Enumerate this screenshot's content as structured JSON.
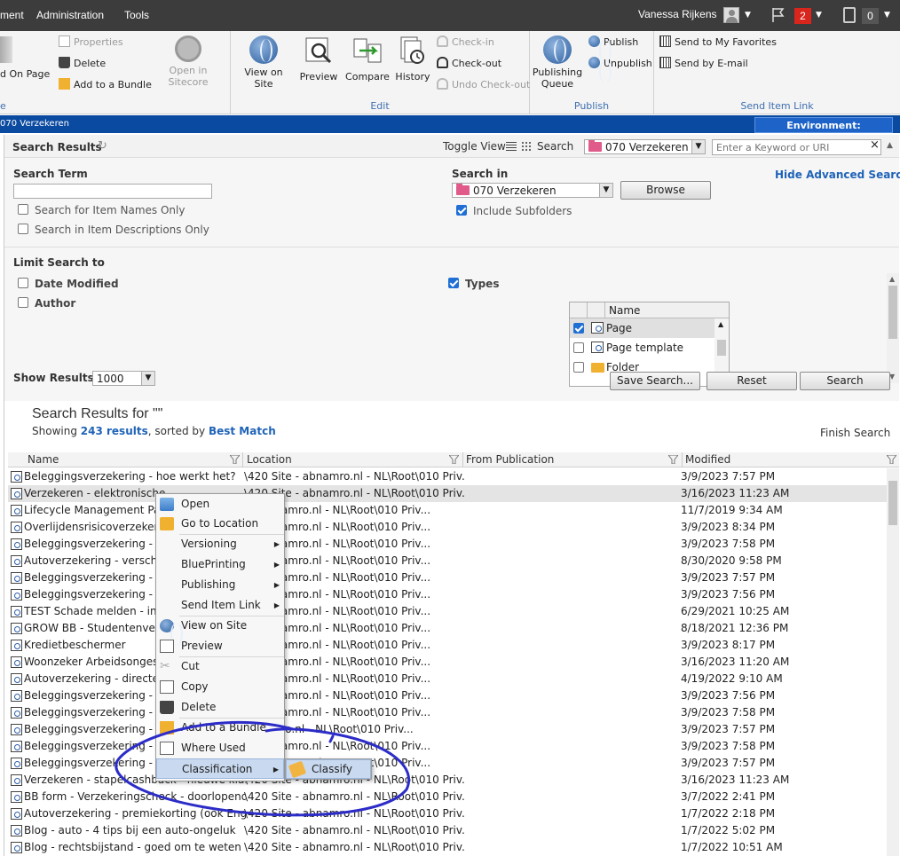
{
  "topbar": {
    "menus": [
      "ment",
      "Administration",
      "Tools"
    ],
    "user_name": "Vanessa Rijkens",
    "notifications_count": "2",
    "clipboard_count": "0"
  },
  "ribbon": {
    "group1": {
      "add_on_page": "d On Page",
      "properties": "Properties",
      "delete": "Delete",
      "add_to_bundle": "Add to a Bundle",
      "open_in_sitecore": "Open in Sitecore",
      "label": "e"
    },
    "edit": {
      "view_on_site": "View on Site",
      "preview": "Preview",
      "compare": "Compare",
      "history": "History",
      "check_in": "Check-in",
      "check_out": "Check-out",
      "undo_check_out": "Undo Check-out",
      "label": "Edit"
    },
    "publish": {
      "publishing_queue_1": "Publishing",
      "publishing_queue_2": "Queue",
      "publish": "Publish",
      "unpublish": "Unpublish",
      "label": "Publish"
    },
    "send": {
      "favorites": "Send to My Favorites",
      "email": "Send by E-mail",
      "label": "Send Item Link"
    }
  },
  "bluebar": {
    "path": "070 Verzekeren",
    "environment": "Environment: Production"
  },
  "search_panel": {
    "title": "Search Results",
    "toggle_view": "Toggle View",
    "search_label": "Search",
    "search_scope": "070 Verzekeren",
    "keyword_placeholder": "Enter a Keyword or URI",
    "search_term_label": "Search Term",
    "search_term_value": "",
    "item_names_only": "Search for Item Names Only",
    "item_descriptions_only": "Search in Item Descriptions Only",
    "search_in_label": "Search in",
    "search_in_value": "070 Verzekeren",
    "browse": "Browse",
    "include_subfolders": "Include Subfolders",
    "hide_advanced": "Hide Advanced Search",
    "limit_label": "Limit Search to",
    "date_modified": "Date Modified",
    "author": "Author",
    "types_label": "Types",
    "types_col": "Name",
    "types": [
      {
        "name": "Page",
        "checked": true
      },
      {
        "name": "Page template",
        "checked": false
      },
      {
        "name": "Folder",
        "checked": false
      }
    ],
    "show_results_label": "Show Results",
    "show_results_value": "1000",
    "save_search": "Save Search...",
    "reset": "Reset",
    "search_btn": "Search"
  },
  "results": {
    "heading": "Search Results for \"\"",
    "showing_prefix": "Showing",
    "count_text": "243 results",
    "sorted_by": ", sorted by",
    "sort_mode": "Best Match",
    "finish": "Finish Search",
    "columns": [
      "Name",
      "Location",
      "From Publication",
      "Modified"
    ],
    "rows": [
      {
        "name": "Beleggingsverzekering - hoe werkt het?",
        "location": "\\420 Site - abnamro.nl - NL\\Root\\010 Priv...",
        "modified": "3/9/2023 7:57 PM"
      },
      {
        "name": "Verzekeren - elektronische",
        "location": "\\420 Site - abnamro.nl - NL\\Root\\010 Priv...",
        "modified": "3/16/2023 11:23 AM"
      },
      {
        "name": "Lifecycle Management Pagi",
        "location": "e - abnamro.nl - NL\\Root\\010 Priv...",
        "modified": "11/7/2019 9:34 AM"
      },
      {
        "name": "Overlijdensrisicoverzekerin",
        "location": "e - abnamro.nl - NL\\Root\\010 Priv...",
        "modified": "3/9/2023 8:34 PM"
      },
      {
        "name": "Beleggingsverzekering - wi",
        "location": "e - abnamro.nl - NL\\Root\\010 Priv...",
        "modified": "3/9/2023 7:58 PM"
      },
      {
        "name": "Autoverzekering - verschil",
        "location": "e - abnamro.nl - NL\\Root\\010 Priv...",
        "modified": "8/30/2020 9:58 PM"
      },
      {
        "name": "Beleggingsverzekering - co",
        "location": "e - abnamro.nl - NL\\Root\\010 Priv...",
        "modified": "3/9/2023 7:57 PM"
      },
      {
        "name": "Beleggingsverzekering - AS",
        "location": "e - abnamro.nl - NL\\Root\\010 Priv...",
        "modified": "3/9/2023 7:56 PM"
      },
      {
        "name": "TEST Schade melden - inde",
        "location": "e - abnamro.nl - NL\\Root\\010 Priv...",
        "modified": "6/29/2021 10:25 AM"
      },
      {
        "name": "GROW BB - Studentenverz",
        "location": "e - abnamro.nl - NL\\Root\\010 Priv...",
        "modified": "8/18/2021 12:36 PM"
      },
      {
        "name": "Kredietbeschermer",
        "location": "e - abnamro.nl - NL\\Root\\010 Priv...",
        "modified": "3/9/2023 8:17 PM"
      },
      {
        "name": "Woonzeker Arbeidsongesch",
        "location": "e - abnamro.nl - NL\\Root\\010 Priv...",
        "modified": "3/16/2023 11:20 AM"
      },
      {
        "name": "Autoverzekering - directe s",
        "location": "e - abnamro.nl - NL\\Root\\010 Priv...",
        "modified": "4/19/2022 9:10 AM"
      },
      {
        "name": "Beleggingsverzekering - AE",
        "location": "e - abnamro.nl - NL\\Root\\010 Priv...",
        "modified": "3/9/2023 7:56 PM"
      },
      {
        "name": "Beleggingsverzekering - ris",
        "location": "e - abnamro.nl - NL\\Root\\010 Priv...",
        "modified": "3/9/2023 7:58 PM"
      },
      {
        "name": "Beleggingsverzekering - be",
        "location": "abnamro.nl - NL\\Root\\010 Priv...",
        "modified": "3/9/2023 7:57 PM"
      },
      {
        "name": "Beleggingsverzekering - wa",
        "location": "e - abnamro.nl - NL\\Root\\010 Priv...",
        "modified": "3/9/2023 7:58 PM"
      },
      {
        "name": "Beleggingsverzekering - ind",
        "location": "e - abnamro.nl - NL\\Root\\010 Priv...",
        "modified": "3/9/2023 7:57 PM"
      },
      {
        "name": "Verzekeren - stapelcashback - nieuwe kla...",
        "location": "\\420 Site - abnamro.nl - NL\\Root\\010 Priv...",
        "modified": "3/16/2023 11:23 AM"
      },
      {
        "name": "BB form - Verzekeringscheck - doorlopend...",
        "location": "\\420 Site - abnamro.nl - NL\\Root\\010 Priv...",
        "modified": "3/7/2022 2:41 PM"
      },
      {
        "name": "Autoverzekering - premiekorting (ook Eng...",
        "location": "\\420 Site - abnamro.nl - NL\\Root\\010 Priv...",
        "modified": "1/7/2022 2:18 PM"
      },
      {
        "name": "Blog - auto - 4 tips bij een auto-ongeluk",
        "location": "\\420 Site - abnamro.nl - NL\\Root\\010 Priv...",
        "modified": "1/7/2022 5:02 PM"
      },
      {
        "name": "Blog - rechtsbijstand - goed om te weten ...",
        "location": "\\420 Site - abnamro.nl - NL\\Root\\010 Priv...",
        "modified": "1/7/2022 10:51 AM"
      }
    ]
  },
  "context_menu": {
    "items": [
      "Open",
      "Go to Location",
      "Versioning",
      "BluePrinting",
      "Publishing",
      "Send Item Link",
      "View on Site",
      "Preview",
      "Cut",
      "Copy",
      "Delete",
      "Add to a Bundle",
      "Where Used",
      "Classification"
    ],
    "submenu_item": "Classify"
  }
}
